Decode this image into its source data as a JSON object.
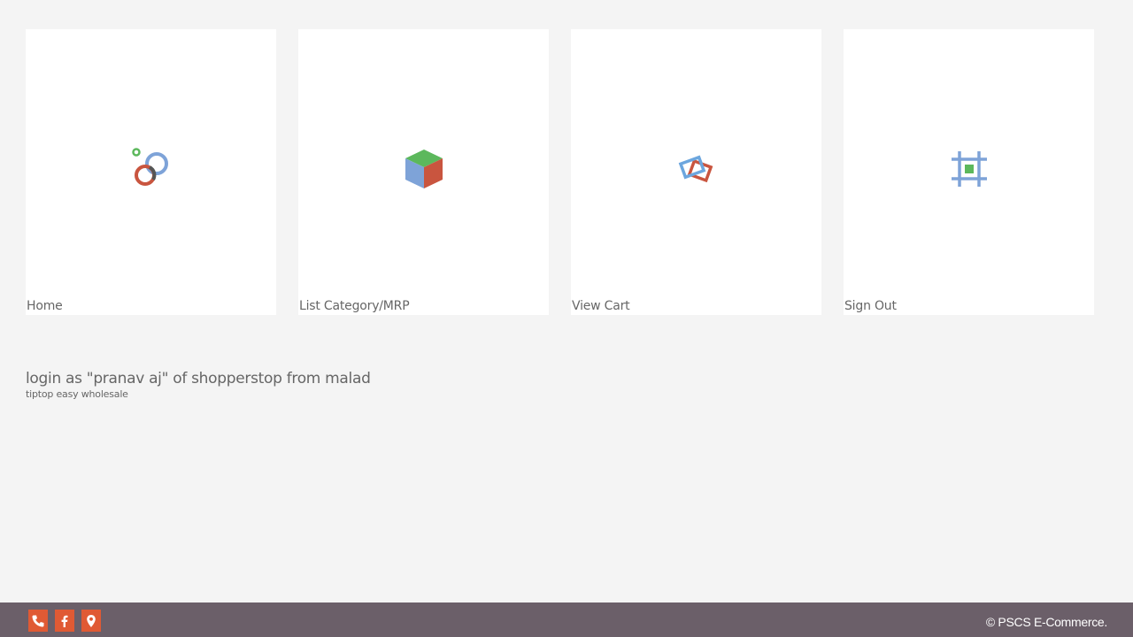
{
  "tiles": [
    {
      "label": "Home",
      "icon": "rings-icon"
    },
    {
      "label": "List Category/MRP",
      "icon": "cube-icon"
    },
    {
      "label": "View Cart",
      "icon": "overlapping-frames-icon"
    },
    {
      "label": "Sign Out",
      "icon": "crop-frame-icon"
    }
  ],
  "info": {
    "login_text": "login as \"pranav aj\" of shopperstop from malad",
    "subtitle": "tiptop easy wholesale"
  },
  "footer": {
    "social": [
      "phone-icon",
      "facebook-icon",
      "location-pin-icon"
    ],
    "copyright": "© PSCS E-Commerce."
  },
  "colors": {
    "background": "#f4f4f4",
    "tile": "#ffffff",
    "footer": "#6b5f69",
    "social_button": "#e05a34"
  }
}
